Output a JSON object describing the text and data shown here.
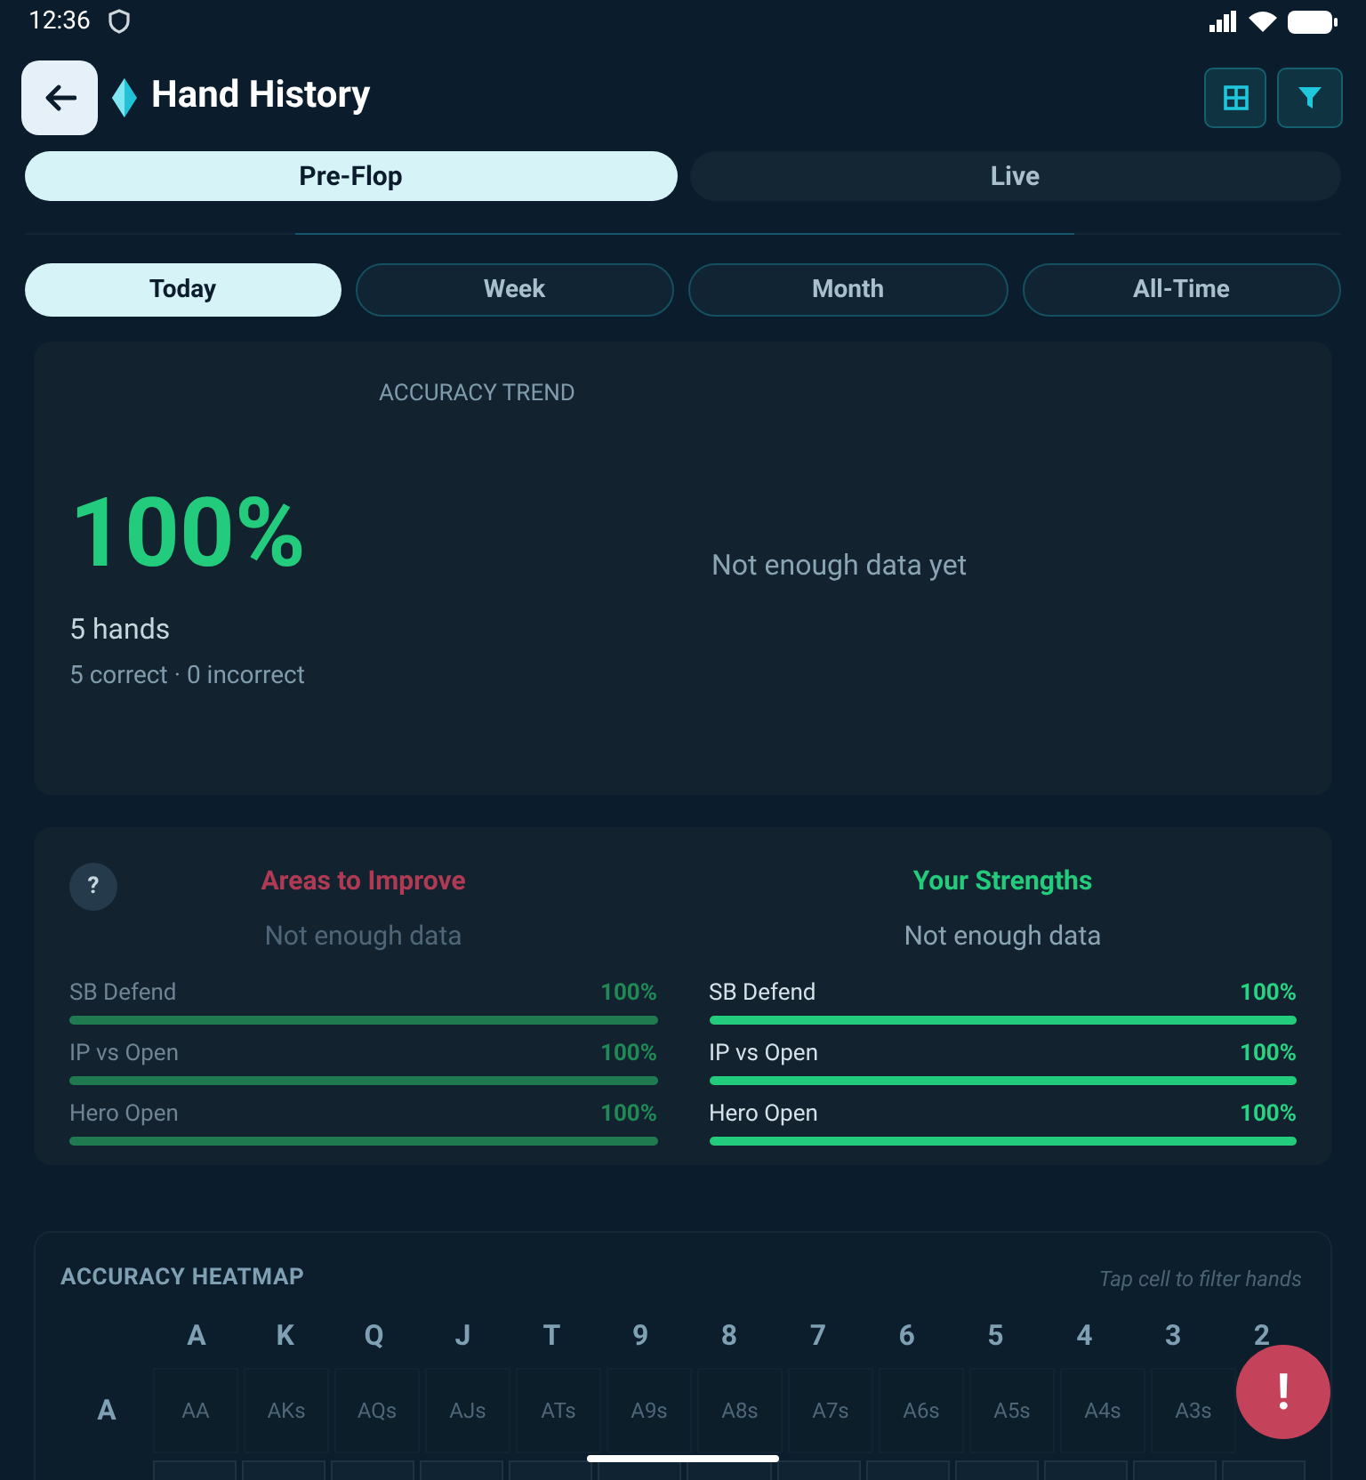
{
  "status_bar": {
    "time": "12:36"
  },
  "header": {
    "title": "Hand History"
  },
  "mode_tabs": [
    {
      "label": "Pre-Flop",
      "selected": true
    },
    {
      "label": "Live",
      "selected": false
    }
  ],
  "period_tabs": [
    {
      "label": "Today",
      "selected": true
    },
    {
      "label": "Week",
      "selected": false
    },
    {
      "label": "Month",
      "selected": false
    },
    {
      "label": "All-Time",
      "selected": false
    }
  ],
  "summary": {
    "trend_title": "ACCURACY TREND",
    "accuracy": "100%",
    "hands": "5 hands",
    "breakdown": "5 correct · 0 incorrect",
    "trend_message": "Not enough data yet"
  },
  "help_button": "?",
  "areas_to_improve": {
    "title": "Areas to Improve",
    "message": "Not enough data",
    "items": [
      {
        "label": "SB Defend",
        "value": "100%",
        "level": 1
      },
      {
        "label": "IP vs Open",
        "value": "100%",
        "level": 1
      },
      {
        "label": "Hero Open",
        "value": "100%",
        "level": 1
      }
    ]
  },
  "strengths": {
    "title": "Your Strengths",
    "message": "Not enough data",
    "items": [
      {
        "label": "SB Defend",
        "value": "100%",
        "level": 1
      },
      {
        "label": "IP vs Open",
        "value": "100%",
        "level": 1
      },
      {
        "label": "Hero Open",
        "value": "100%",
        "level": 1
      }
    ]
  },
  "heatmap": {
    "title": "ACCURACY HEATMAP",
    "hint": "Tap cell to filter hands",
    "columns": [
      "A",
      "K",
      "Q",
      "J",
      "T",
      "9",
      "8",
      "7",
      "6",
      "5",
      "4",
      "3",
      "2"
    ],
    "rows": [
      {
        "label": "A",
        "cells": [
          "AA",
          "AKs",
          "AQs",
          "AJs",
          "ATs",
          "A9s",
          "A8s",
          "A7s",
          "A6s",
          "A5s",
          "A4s",
          "A3s"
        ]
      }
    ]
  },
  "alert_button": "!"
}
